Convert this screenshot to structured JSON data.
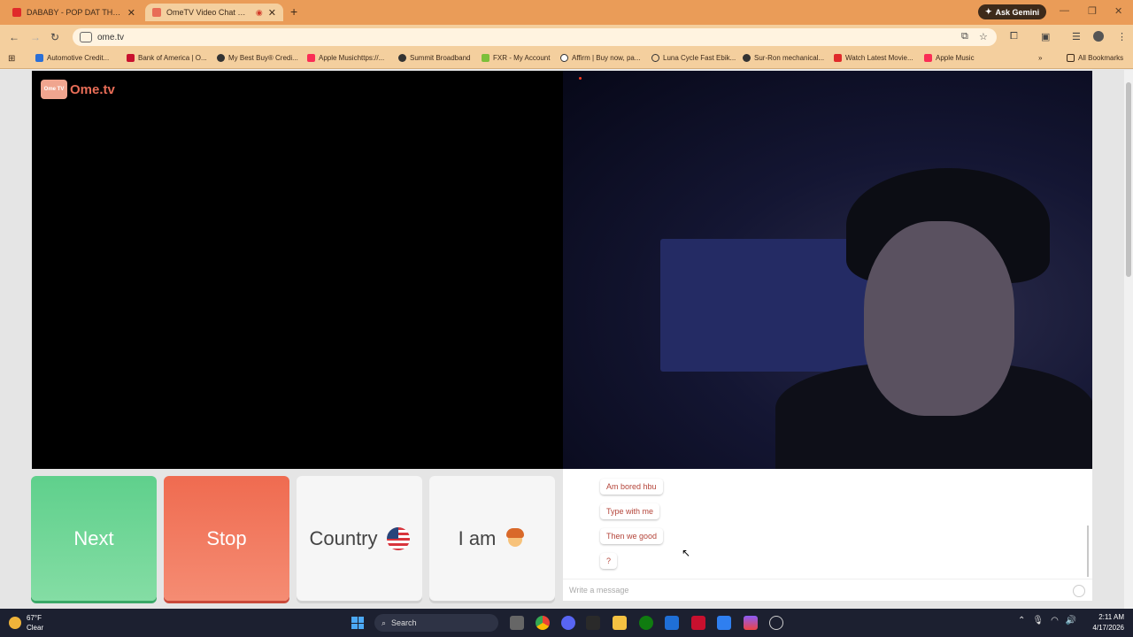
{
  "browser": {
    "tabs": [
      {
        "title": "DABABY - POP DAT THANG (Of",
        "active": false
      },
      {
        "title": "OmeTV Video Chat — Omeg",
        "active": true
      }
    ],
    "ask_gemini": "Ask Gemini",
    "url": "ome.tv",
    "bookmarks": [
      {
        "label": "Automotive Credit..."
      },
      {
        "label": "Bank of America | O..."
      },
      {
        "label": "My Best Buy® Credi..."
      },
      {
        "label": "Apple Musichttps://..."
      },
      {
        "label": "Summit Broadband"
      },
      {
        "label": "FXR - My Account"
      },
      {
        "label": "Affirm | Buy now, pa..."
      },
      {
        "label": "Luna Cycle Fast Ebik..."
      },
      {
        "label": "Sur-Ron mechanical..."
      },
      {
        "label": "Watch Latest Movie..."
      },
      {
        "label": "Apple Music"
      }
    ],
    "all_bookmarks": "All Bookmarks"
  },
  "ometv": {
    "logo_text": "Ome.tv",
    "logo_badge": "Ome TV",
    "buttons": {
      "next": "Next",
      "stop": "Stop",
      "country": "Country",
      "iam": "I am"
    },
    "messages": [
      "Am bored hbu",
      "Type with me",
      "Then we good",
      "?"
    ],
    "compose_placeholder": "Write a message"
  },
  "taskbar": {
    "temperature": "67°F",
    "condition": "Clear",
    "search": "Search",
    "time": "2:11 AM",
    "date": "4/17/2026"
  },
  "colors": {
    "tabbar": "#ea9c58",
    "toolbar": "#f4cf9e",
    "next_green": "#5fd08c",
    "stop_red": "#ef6b50",
    "message_text": "#b4453a"
  }
}
